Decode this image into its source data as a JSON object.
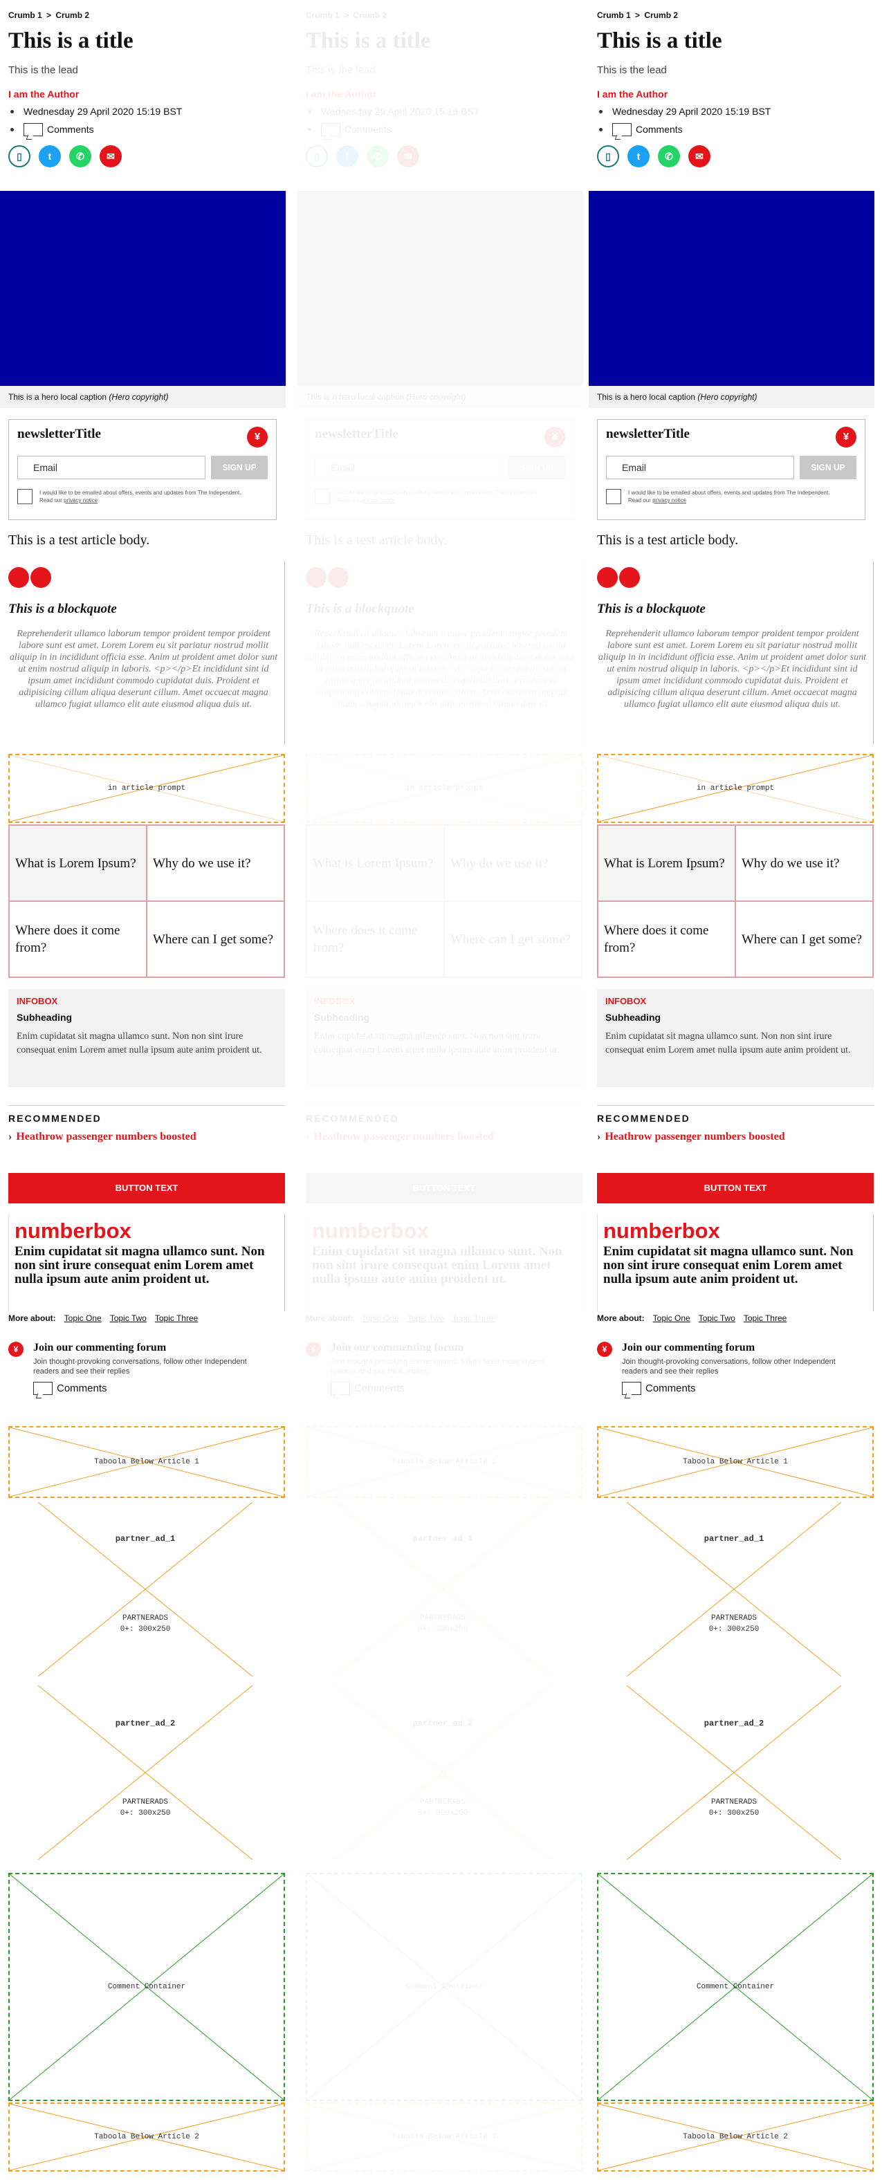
{
  "columns": [
    {
      "variant": "default"
    },
    {
      "variant": "faded"
    },
    {
      "variant": "default"
    }
  ],
  "breadcrumbs": [
    "Crumb 1",
    ">",
    "Crumb 2"
  ],
  "title": "This is a title",
  "lead": "This is the lead",
  "author": "I am the Author",
  "date": "Wednesday 29 April 2020 15:19 BST",
  "comments_label": "Comments",
  "share_icons": [
    "bookmark-icon",
    "twitter-icon",
    "whatsapp-icon",
    "email-icon"
  ],
  "hero": {
    "caption": "This is a hero local caption",
    "copyright": "(Hero copyright)",
    "color": "#0000a0"
  },
  "newsletter": {
    "title": "newsletterTitle",
    "email_placeholder": "Email",
    "signup_label": "SIGN UP",
    "consent": "I would like to be emailed about offers, events and updates from The Independent. Read our",
    "privacy_link": "privacy notice"
  },
  "article_body": "This is a test article body.",
  "blockquote": {
    "title": "This is a blockquote",
    "text": "Reprehenderit ullamco laborum tempor proident tempor proident labore sunt est amet. Lorem Lorem eu sit pariatur nostrud mollit aliquip in in incididunt officia esse. Anim ut proident amet dolor sunt ut enim nostrud aliquip in laboris. <p></p>Et incididunt sint id ipsum amet incididunt commodo cupidatat duis. Proident et adipisicing cillum aliqua deserunt cillum. Amet occaecat magna ullamco fugiat ullamco elit aute eiusmod aliqua duis ut."
  },
  "in_article_prompt": "in article prompt",
  "faq": [
    "What is Lorem Ipsum?",
    "Why do we use it?",
    "Where does it come from?",
    "Where can I get some?"
  ],
  "infobox": {
    "title": "INFOBOX",
    "subheading": "Subheading",
    "text": "Enim cupidatat sit magna ullamco sunt. Non non sint irure consequat enim Lorem amet nulla ipsum aute anim proident ut."
  },
  "recommended": {
    "title": "RECOMMENDED",
    "link": "Heathrow passenger numbers boosted"
  },
  "button_text": "BUTTON TEXT",
  "numberbox": {
    "title": "numberbox",
    "text": "Enim cupidatat sit magna ullamco sunt. Non non sint irure consequat enim Lorem amet nulla ipsum aute anim proident ut."
  },
  "more_about": {
    "label": "More about:",
    "topics": [
      "Topic One",
      "Topic Two",
      "Topic Three"
    ]
  },
  "forum": {
    "title": "Join our commenting forum",
    "text": "Join thought-provoking conversations, follow other Independent readers and see their replies",
    "comments": "Comments"
  },
  "placeholders": {
    "taboola_1": "Taboola Below Article 1",
    "partner_ad_1": "partner_ad_1",
    "partner_ad_2": "partner_ad_2",
    "partnerads": "PARTNERADS",
    "partnerads_size": "0+: 300x250",
    "comment_container": "Comment Container",
    "taboola_2": "Taboola Below Article 2"
  },
  "colors": {
    "brand_red": "#e3151a",
    "placeholder_orange": "#f0a020",
    "placeholder_green": "#2a9a2a"
  }
}
